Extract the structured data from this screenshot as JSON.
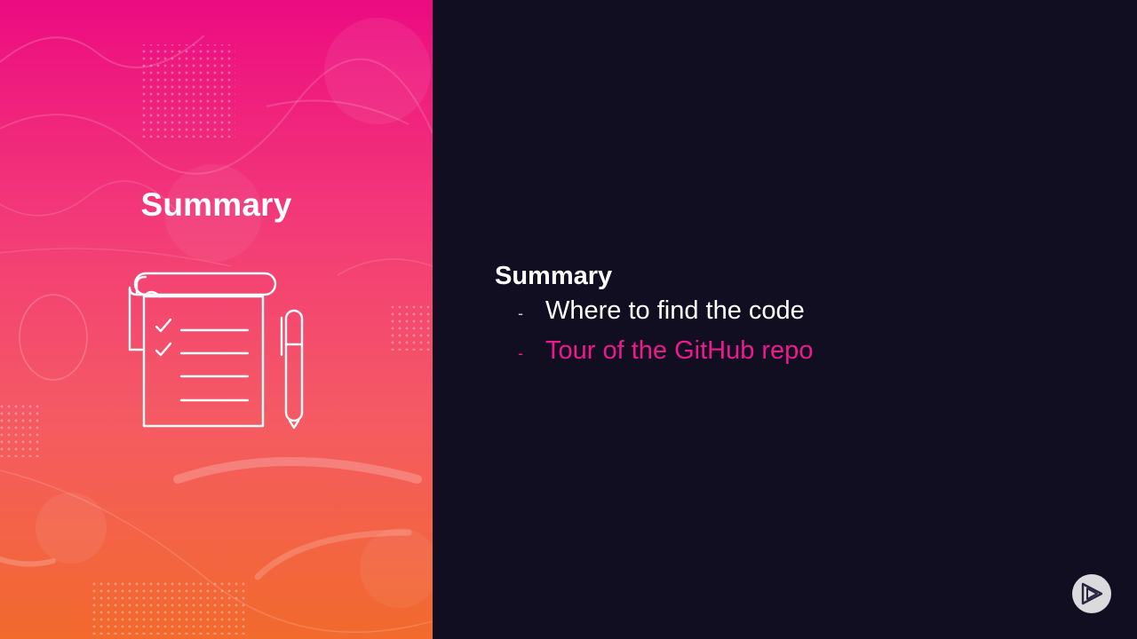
{
  "left_panel": {
    "title": "Summary",
    "icon": "notepad-checklist-pen-icon"
  },
  "content": {
    "heading": "Summary",
    "bullets": [
      {
        "dash": "-",
        "text": "Where to find the code",
        "highlighted": false
      },
      {
        "dash": "-",
        "text": "Tour of the GitHub repo",
        "highlighted": true
      }
    ]
  },
  "brand": {
    "logo": "play-logo-icon"
  },
  "colors": {
    "background": "#120e22",
    "gradient_top": "#ec0b81",
    "gradient_bottom": "#f26a2c",
    "highlight": "#ec1a8a",
    "text": "#ffffff"
  }
}
